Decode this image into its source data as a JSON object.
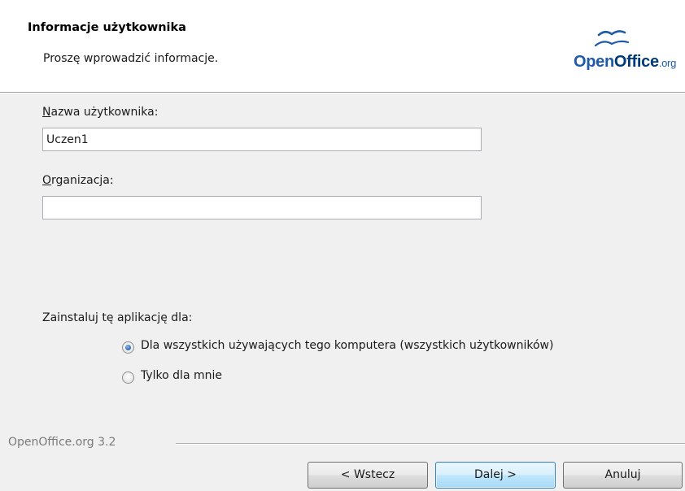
{
  "header": {
    "title": "Informacje użytkownika",
    "subtitle": "Proszę wprowadzić informacje.",
    "logo": {
      "open": "Open",
      "office": "Office",
      "org": ".org",
      "icon": "seagulls-icon"
    }
  },
  "form": {
    "username_label_first": "N",
    "username_label_rest": "azwa użytkownika:",
    "username_value": "Uczen1",
    "organization_label_first": "O",
    "organization_label_rest": "rganizacja:",
    "organization_value": ""
  },
  "install_for": {
    "label": "Zainstaluj tę aplikację dla:",
    "options": [
      {
        "label": "Dla wszystkich używających tego komputera (wszystkich użytkowników)",
        "selected": true
      },
      {
        "label": "Tylko dla mnie",
        "selected": false
      }
    ]
  },
  "footer": {
    "version": "OpenOffice.org 3.2",
    "back_label": "< Wstecz",
    "next_label": "Dalej >",
    "cancel_label": "Anuluj"
  },
  "colors": {
    "accent": "#3c7fb1",
    "logo_blue": "#1e5aa8",
    "logo_dark": "#003a7a"
  }
}
